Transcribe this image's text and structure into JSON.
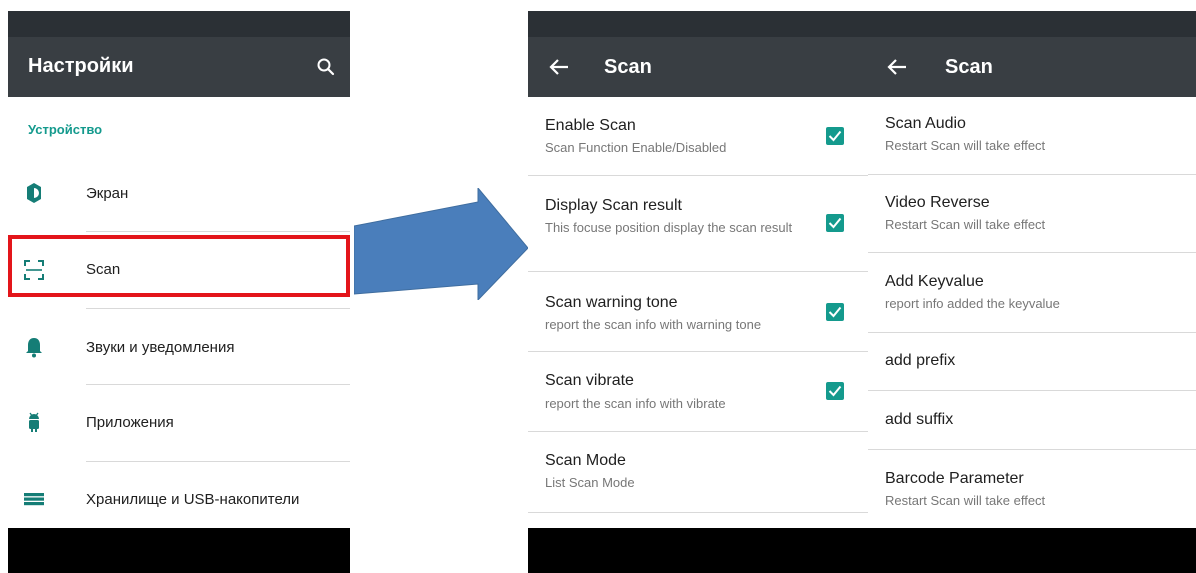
{
  "colors": {
    "accent": "#149a8d",
    "toolbar": "#393e43",
    "statusbar": "#2b3035",
    "highlight": "#e3151a",
    "arrow": "#4a7ebb"
  },
  "settings": {
    "title": "Настройки",
    "section": "Устройство",
    "items": [
      {
        "label": "Экран",
        "icon": "brightness-icon"
      },
      {
        "label": "Scan",
        "icon": "scan-frame-icon",
        "highlighted": true
      },
      {
        "label": "Звуки и уведомления",
        "icon": "bell-icon"
      },
      {
        "label": "Приложения",
        "icon": "android-icon"
      },
      {
        "label": "Хранилище и USB-накопители",
        "icon": "storage-icon"
      }
    ]
  },
  "scan": {
    "title": "Scan",
    "items": [
      {
        "title": "Enable Scan",
        "summary": "Scan Function Enable/Disabled",
        "checked": true
      },
      {
        "title": "Display Scan result",
        "summary": "This focuse position display the scan result",
        "checked": true
      },
      {
        "title": "Scan warning tone",
        "summary": "report the scan info with warning tone",
        "checked": true
      },
      {
        "title": "Scan vibrate",
        "summary": "report the scan info with vibrate",
        "checked": true
      },
      {
        "title": "Scan Mode",
        "summary": "List Scan Mode"
      }
    ]
  },
  "scan2": {
    "title": "Scan",
    "items": [
      {
        "title": "Scan Audio",
        "summary": "Restart Scan will take effect"
      },
      {
        "title": "Video Reverse",
        "summary": "Restart Scan will take effect"
      },
      {
        "title": "Add Keyvalue",
        "summary": "report info added the keyvalue"
      },
      {
        "title": "add prefix"
      },
      {
        "title": "add suffix"
      },
      {
        "title": "Barcode Parameter",
        "summary": "Restart Scan will take effect"
      }
    ]
  }
}
